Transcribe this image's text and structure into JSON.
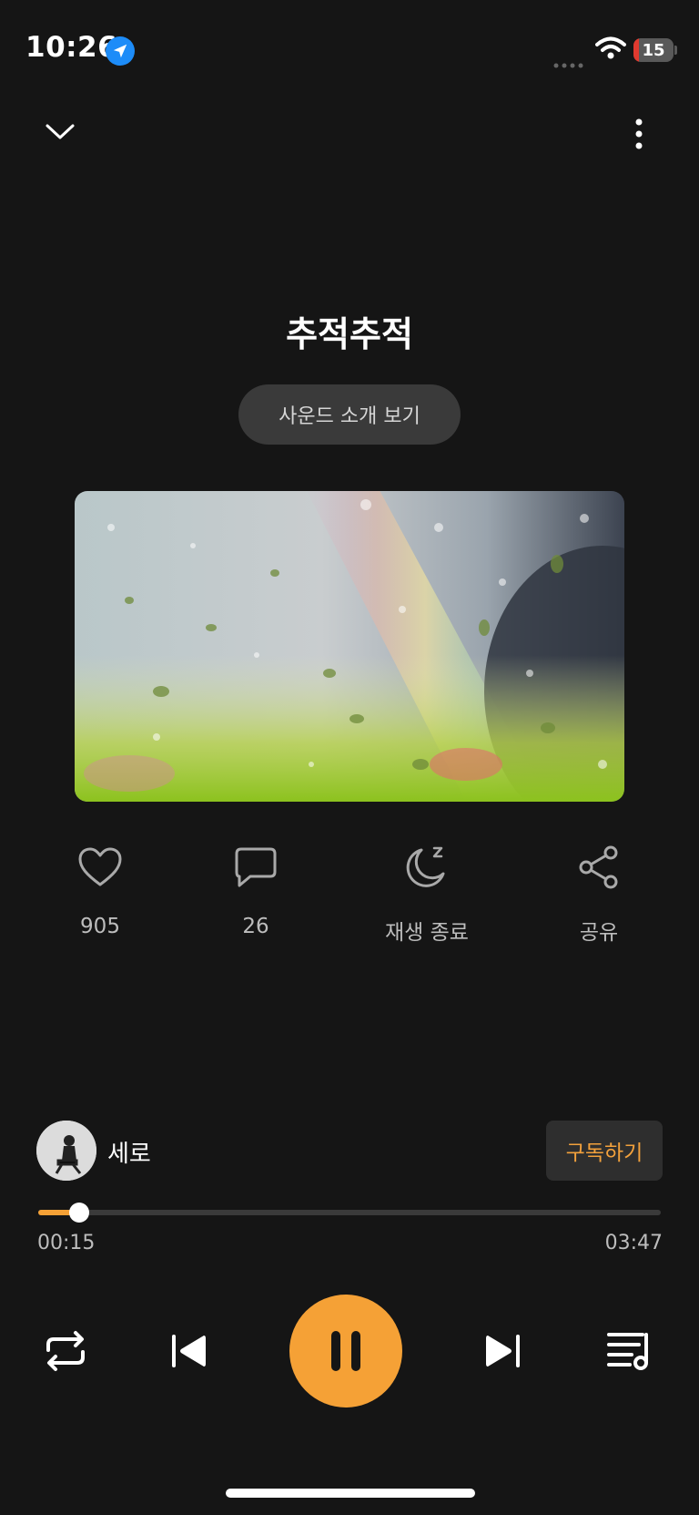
{
  "status_bar": {
    "time": "10:26",
    "battery": "15"
  },
  "track": {
    "title": "추적추적",
    "intro_label": "사운드 소개 보기"
  },
  "actions": [
    {
      "icon": "heart-icon",
      "label": "905"
    },
    {
      "icon": "comment-icon",
      "label": "26"
    },
    {
      "icon": "sleep-timer-icon",
      "label": "재생 종료"
    },
    {
      "icon": "share-icon",
      "label": "공유"
    }
  ],
  "artist": {
    "name": "세로",
    "subscribe_label": "구독하기"
  },
  "progress": {
    "current": "00:15",
    "total": "03:47",
    "fraction": 0.066
  },
  "colors": {
    "accent": "#f5a136",
    "background": "#151515"
  }
}
